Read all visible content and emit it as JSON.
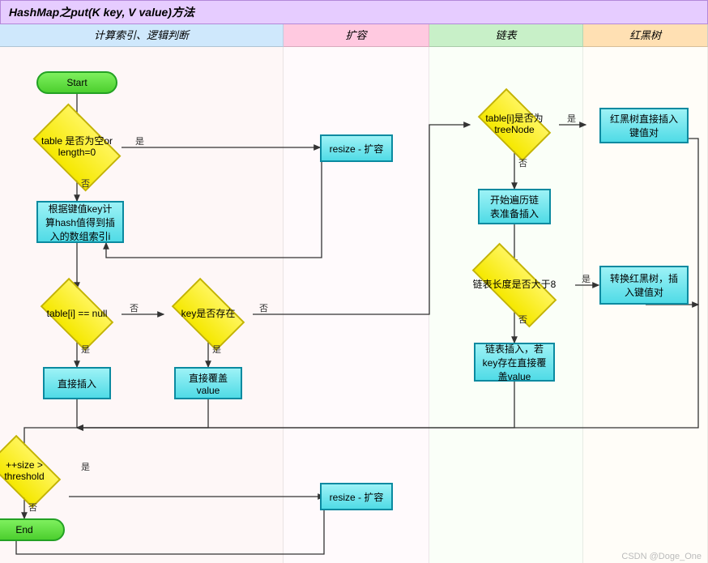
{
  "header": {
    "title": "HashMap之put(K key, V value)方法"
  },
  "columns": {
    "c1": "计算索引、逻辑判断",
    "c2": "扩容",
    "c3": "链表",
    "c4": "红黑树"
  },
  "nodes": {
    "start": "Start",
    "end": "End",
    "d_empty": "table 是否为空or length=0",
    "p_resize1": "resize - 扩容",
    "p_hash": "根据键值key计算hash值得到插入的数组索引i",
    "d_null": "table[i] == null",
    "p_insert": "直接插入",
    "d_keyexist": "key是否存在",
    "p_overwrite": "直接覆盖value",
    "d_size": "++size > threshold",
    "p_resize2": "resize - 扩容",
    "d_treenode": "table[i]是否为treeNode",
    "p_rbtree_insert": "红黑树直接插入键值对",
    "p_traverse": "开始遍历链表准备插入",
    "d_len8": "链表长度是否大于8",
    "p_convert": "转换红黑树，插入键值对",
    "p_list_insert": "链表插入，若key存在直接覆盖value"
  },
  "labels": {
    "yes": "是",
    "no": "否"
  },
  "watermark": "CSDN @Doge_One"
}
